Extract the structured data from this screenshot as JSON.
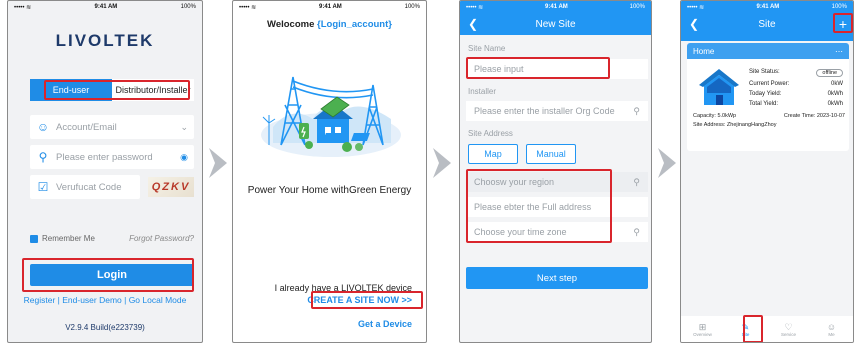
{
  "status": {
    "time": "9:41 AM",
    "battery": "100%"
  },
  "screen1": {
    "logo": "LIVOLTEK",
    "tabs": [
      "End-user",
      "Distributor/Installer"
    ],
    "account_placeholder": "Account/Email",
    "password_placeholder": "Please enter password",
    "code_placeholder": "Verufucat Code",
    "captcha": "QZKV",
    "remember": "Remember Me",
    "forgot": "Forgot Password?",
    "login": "Login",
    "links": "Register  |  End-user Demo  |  Go Local Mode",
    "version": "V2.9.4 Build(e223739)"
  },
  "screen2": {
    "welcome": "Welocome",
    "account": "{Login_account}",
    "slogan": "Power Your Home withGreen Energy",
    "have_device": "I already have a  LIVOLTEK device",
    "create": "CREATE A SITE NOW >>",
    "get_device": "Get a Device"
  },
  "screen3": {
    "title": "New Site",
    "site_name_label": "Site Name",
    "site_name_placeholder": "Please input",
    "installer_label": "Installer",
    "installer_placeholder": "Please enter the installer Org Code",
    "address_label": "Site Address",
    "map": "Map",
    "manual": "Manual",
    "region": "Choosw your region",
    "full_address": "Please ebter the Full address",
    "time_zone": "Choose your time zone",
    "next": "Next step"
  },
  "screen4": {
    "title": "Site",
    "site_name": "Home",
    "status_label": "Site Status:",
    "status_value": "offline",
    "power_label": "Current Power:",
    "power_value": "0kW",
    "today_label": "Today Yield:",
    "today_value": "0kWh",
    "total_label": "Total Yield:",
    "total_value": "0kWh",
    "capacity": "Capacity: 5.0kWp",
    "create_time": "Create Time: 2023-10-07",
    "address": "Site Address: ZhejinangHangZhoy",
    "tabs": [
      "Overview",
      "Site",
      "Service",
      "Me"
    ]
  },
  "colors": {
    "accent": "#2196f3",
    "highlight": "#d9252c"
  }
}
